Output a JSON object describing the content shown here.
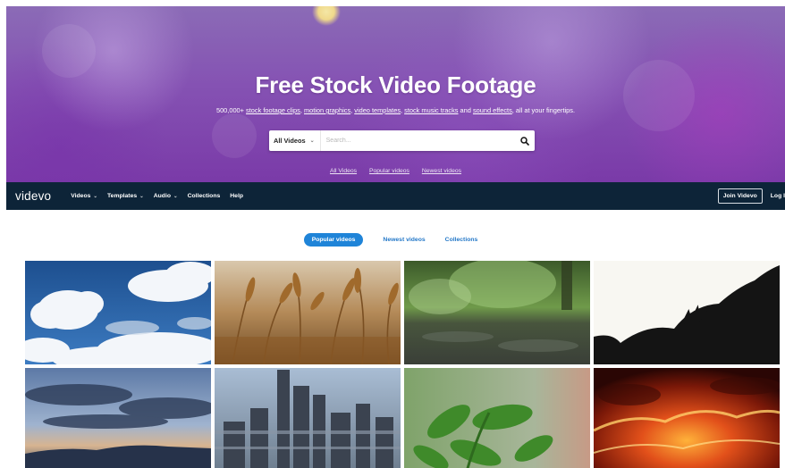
{
  "hero": {
    "title": "Free Stock Video Footage",
    "subtitle_parts": {
      "lead": "500,000+ ",
      "link1": "stock footage clips",
      "sep1": ", ",
      "link2": "motion graphics",
      "sep2": ", ",
      "link3": "video templates",
      "sep3": ", ",
      "link4": "stock music tracks",
      "sep4": " and ",
      "link5": "sound effects",
      "tail": ", all at your fingertips."
    },
    "search": {
      "category": "All Videos",
      "placeholder": "Search...",
      "icon": "search-icon"
    },
    "quick_links": [
      "All Videos",
      "Popular videos",
      "Newest videos"
    ]
  },
  "nav": {
    "logo": "videvo",
    "items": [
      {
        "label": "Videos",
        "has_menu": true
      },
      {
        "label": "Templates",
        "has_menu": true
      },
      {
        "label": "Audio",
        "has_menu": true
      },
      {
        "label": "Collections",
        "has_menu": false
      },
      {
        "label": "Help",
        "has_menu": false
      }
    ],
    "join": "Join Videvo",
    "login": "Log I"
  },
  "tabs": [
    {
      "label": "Popular videos",
      "active": true
    },
    {
      "label": "Newest videos",
      "active": false
    },
    {
      "label": "Collections",
      "active": false
    }
  ],
  "videos": [
    {
      "icon": "clouds-thumbnail"
    },
    {
      "icon": "wheat-field-thumbnail"
    },
    {
      "icon": "rain-puddle-thumbnail"
    },
    {
      "icon": "black-white-splash-thumbnail"
    },
    {
      "icon": "sunset-clouds-thumbnail"
    },
    {
      "icon": "city-skyline-thumbnail"
    },
    {
      "icon": "green-leaves-thumbnail"
    },
    {
      "icon": "lava-thumbnail"
    }
  ],
  "colors": {
    "nav_bg": "#0d2438",
    "accent": "#1f84d8",
    "tab_link": "#2478c8"
  }
}
